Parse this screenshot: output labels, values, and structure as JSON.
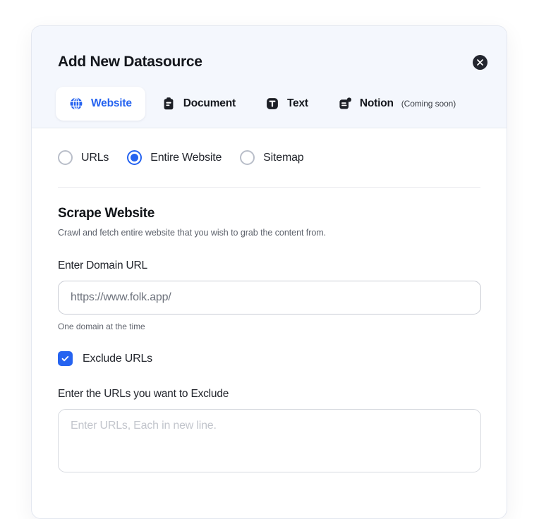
{
  "dialog": {
    "title": "Add New Datasource",
    "close_icon": "close-icon"
  },
  "tabs": [
    {
      "label": "Website",
      "icon": "globe-icon",
      "active": true,
      "note": ""
    },
    {
      "label": "Document",
      "icon": "clipboard-icon",
      "active": false,
      "note": ""
    },
    {
      "label": "Text",
      "icon": "text-t-icon",
      "active": false,
      "note": ""
    },
    {
      "label": "Notion",
      "icon": "notion-icon",
      "active": false,
      "note": "(Coming soon)"
    }
  ],
  "scrape_mode": {
    "options": [
      {
        "label": "URLs",
        "selected": false
      },
      {
        "label": "Entire Website",
        "selected": true
      },
      {
        "label": "Sitemap",
        "selected": false
      }
    ]
  },
  "section": {
    "title": "Scrape Website",
    "subtitle": "Crawl and fetch entire website that you wish to grab the content from."
  },
  "domain_field": {
    "label": "Enter Domain URL",
    "value": "",
    "placeholder": "https://www.folk.app/",
    "hint": "One domain at the time"
  },
  "exclude": {
    "checkbox_label": "Exclude URLs",
    "checked": true,
    "textarea_label": "Enter the URLs you want to Exclude",
    "textarea_value": "",
    "textarea_placeholder": "Enter URLs, Each in new line."
  },
  "colors": {
    "accent": "#2563f0",
    "header_bg": "#f4f7fd",
    "dark": "#23262f",
    "text": "#22252c"
  }
}
